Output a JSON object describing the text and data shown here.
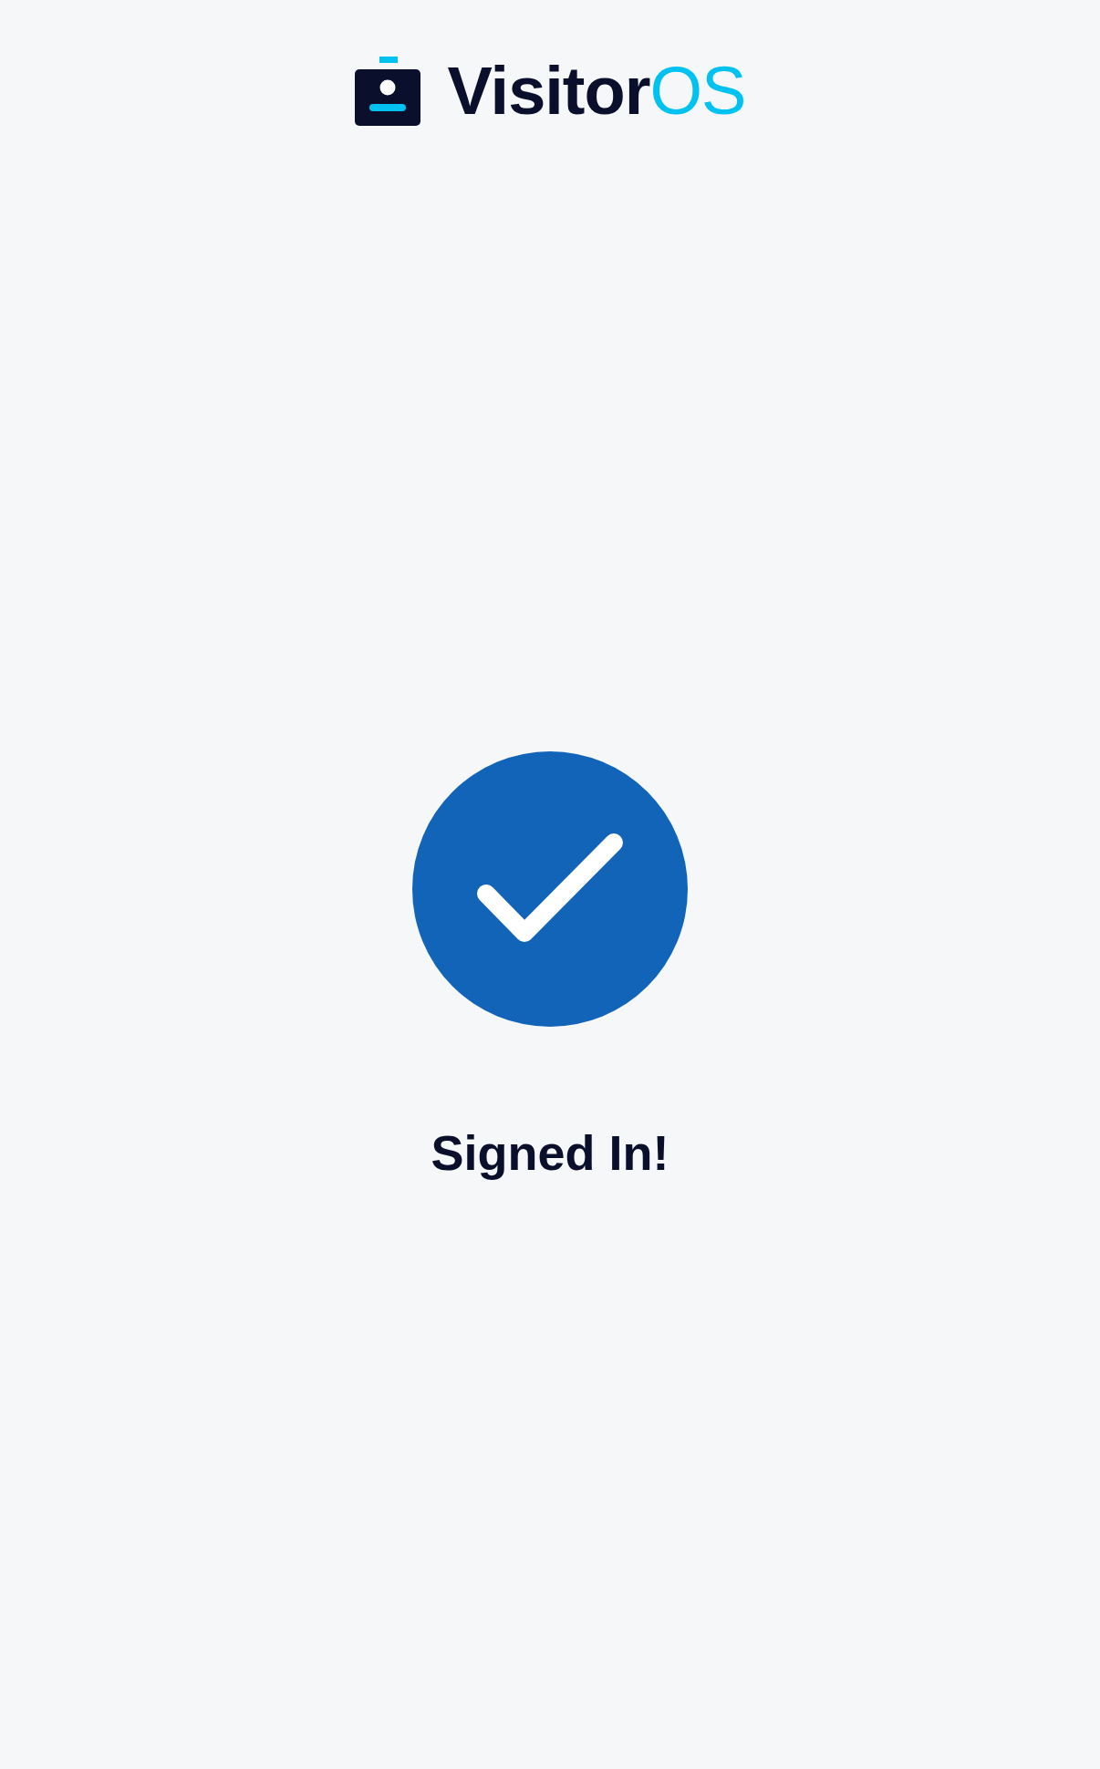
{
  "brand": {
    "name": "Visitor",
    "accent": "OS"
  },
  "message": "Signed In!"
}
